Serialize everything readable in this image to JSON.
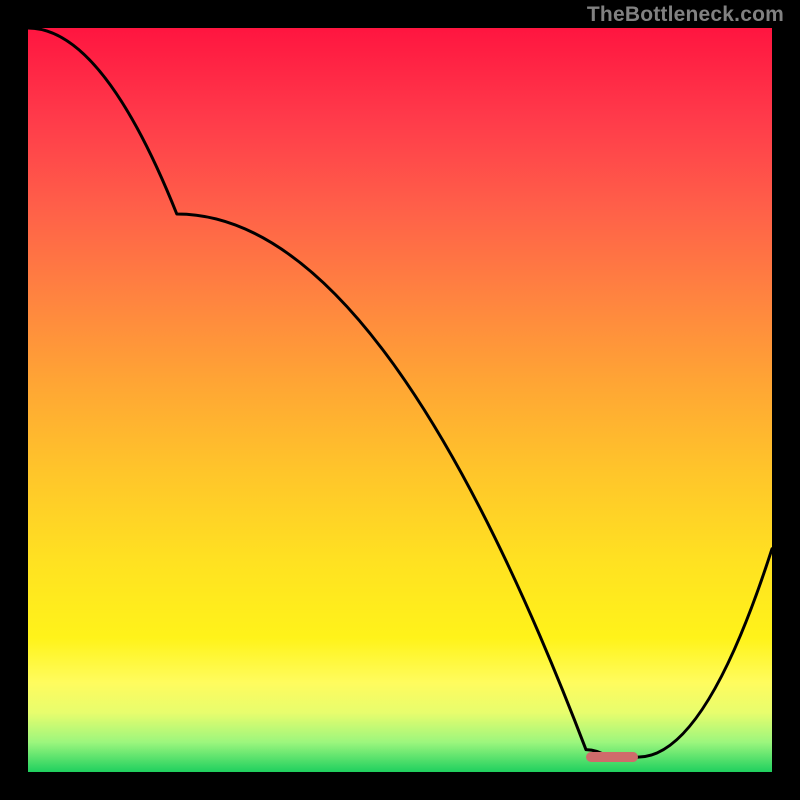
{
  "watermark": "TheBottleneck.com",
  "chart_data": {
    "type": "line",
    "title": "",
    "xlabel": "",
    "ylabel": "",
    "xlim": [
      0,
      100
    ],
    "ylim": [
      0,
      100
    ],
    "series": [
      {
        "name": "curve",
        "x": [
          0,
          20,
          75,
          78,
          82,
          100
        ],
        "values": [
          100,
          75,
          3,
          2,
          2,
          30
        ]
      }
    ],
    "marker": {
      "x_start": 75,
      "x_end": 82,
      "y": 2
    },
    "gradient_stops": [
      {
        "pct": 0,
        "color": "#ff1540"
      },
      {
        "pct": 12,
        "color": "#ff3a4a"
      },
      {
        "pct": 24,
        "color": "#ff5f49"
      },
      {
        "pct": 36,
        "color": "#ff8340"
      },
      {
        "pct": 48,
        "color": "#ffa634"
      },
      {
        "pct": 60,
        "color": "#ffc62a"
      },
      {
        "pct": 72,
        "color": "#ffe221"
      },
      {
        "pct": 82,
        "color": "#fff31a"
      },
      {
        "pct": 88,
        "color": "#fffc5e"
      },
      {
        "pct": 92,
        "color": "#e8fd6d"
      },
      {
        "pct": 96,
        "color": "#9cf67d"
      },
      {
        "pct": 100,
        "color": "#1fd05f"
      }
    ]
  }
}
